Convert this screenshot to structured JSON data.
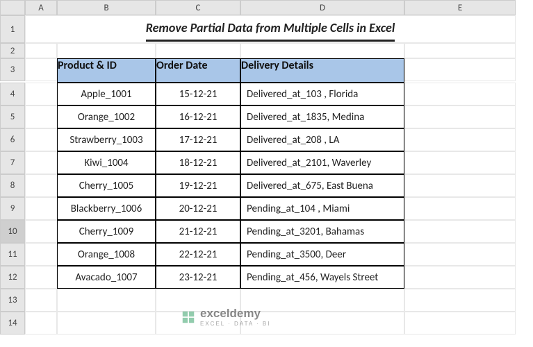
{
  "columns": [
    "A",
    "B",
    "C",
    "D",
    "E"
  ],
  "rows": [
    "1",
    "2",
    "3",
    "4",
    "5",
    "6",
    "7",
    "8",
    "9",
    "10",
    "11",
    "12",
    "13",
    "14"
  ],
  "selected_row": "10",
  "title": "Remove Partial Data from Multiple Cells in Excel",
  "headers": {
    "product": "Product & ID",
    "order": "Order Date",
    "delivery": "Delivery Details"
  },
  "data": [
    {
      "product": "Apple_1001",
      "order": "15-12-21",
      "delivery": "Delivered_at_103 , Florida"
    },
    {
      "product": "Orange_1002",
      "order": "16-12-21",
      "delivery": "Delivered_at_1835, Medina"
    },
    {
      "product": "Strawberry_1003",
      "order": "17-12-21",
      "delivery": "Delivered_at_208 , LA"
    },
    {
      "product": "Kiwi_1004",
      "order": "18-12-21",
      "delivery": "Delivered_at_2101, Waverley"
    },
    {
      "product": "Cherry_1005",
      "order": "19-12-21",
      "delivery": "Delivered_at_675, East Buena"
    },
    {
      "product": "Blackberry_1006",
      "order": "20-12-21",
      "delivery": "Pending_at_104 , Miami"
    },
    {
      "product": "Cherry_1009",
      "order": "21-12-21",
      "delivery": "Pending_at_3201, Bahamas"
    },
    {
      "product": "Orange_1008",
      "order": "22-12-21",
      "delivery": "Pending_at_3500, Deer"
    },
    {
      "product": "Avacado_1007",
      "order": "23-12-21",
      "delivery": "Pending_at_456, Wayels Street"
    }
  ],
  "watermark": {
    "brand": "exceldemy",
    "tagline": "EXCEL · DATA · BI"
  }
}
